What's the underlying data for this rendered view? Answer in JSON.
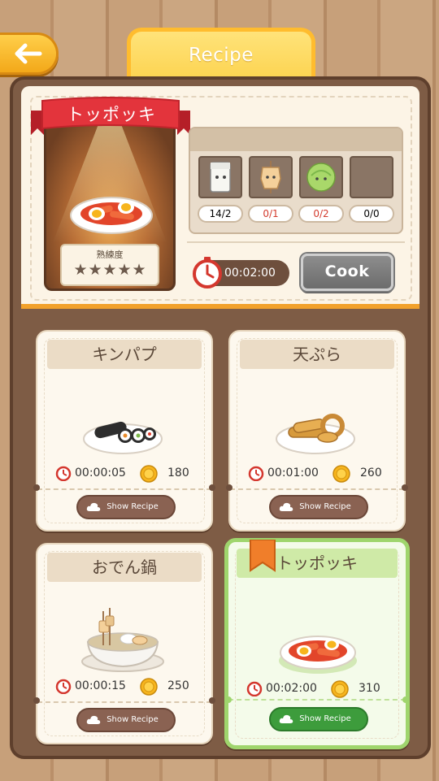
{
  "header": {
    "title": "Recipe",
    "back_icon": "arrow-left-icon"
  },
  "selected": {
    "name": "トッポッキ",
    "mastery_label": "熟練度",
    "stars_filled": 0,
    "stars_total": 5,
    "ingredients": [
      {
        "icon": "tofu-icon",
        "count": "14/2",
        "count_color": "#333333"
      },
      {
        "icon": "fishcake-skewer-icon",
        "count": "0/1",
        "count_color": "#d33a2c"
      },
      {
        "icon": "cabbage-icon",
        "count": "0/2",
        "count_color": "#d33a2c"
      },
      {
        "icon": "empty-slot",
        "count": "0/0",
        "count_color": "#333333"
      }
    ],
    "cook_time": "00:02:00",
    "cook_label": "Cook"
  },
  "recipes": [
    {
      "name": "キンパプ",
      "time": "00:00:05",
      "price": "180",
      "button": "Show Recipe",
      "icon": "kimbap-icon"
    },
    {
      "name": "天ぷら",
      "time": "00:01:00",
      "price": "260",
      "button": "Show Recipe",
      "icon": "tempura-icon"
    },
    {
      "name": "おでん鍋",
      "time": "00:00:15",
      "price": "250",
      "button": "Show Recipe",
      "icon": "oden-pot-icon"
    },
    {
      "name": "トッポッキ",
      "time": "00:02:00",
      "price": "310",
      "button": "Show Recipe",
      "icon": "tteokbokki-icon"
    }
  ],
  "colors": {
    "accent": "#fcd24c",
    "frame": "#7e5c45",
    "selected_border": "#9fd56d",
    "cook_disabled": "#7a7a7a"
  }
}
